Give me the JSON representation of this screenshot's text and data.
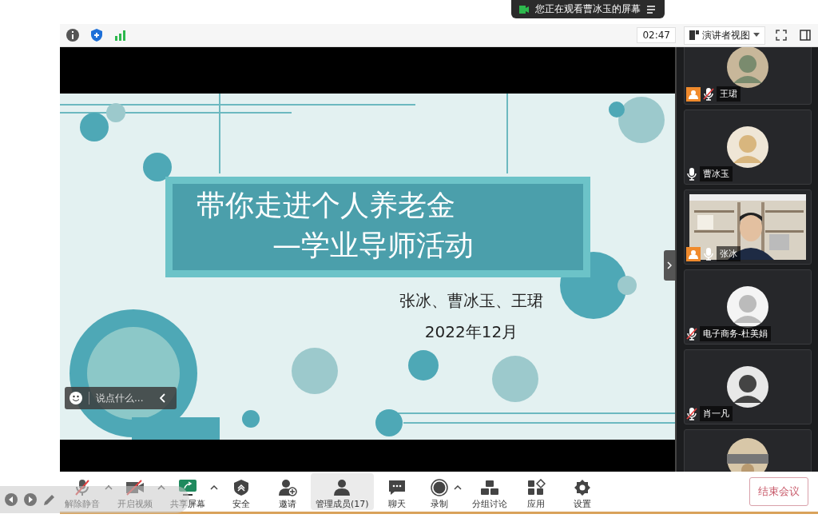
{
  "notice": {
    "text": "您正在观看曹冰玉的屏幕"
  },
  "top_bar": {
    "timer": "02:47",
    "view_button": "演讲者视图"
  },
  "slide": {
    "title_lines": [
      "带你走进个人养老金",
      "—学业导师活动"
    ],
    "authors": "张冰、曹冰玉、王珺",
    "date": "2022年12月"
  },
  "chat_box": {
    "placeholder": "说点什么..."
  },
  "participants": [
    {
      "name": "王珺",
      "muted": true,
      "host": true,
      "kind": "avatar"
    },
    {
      "name": "曹冰玉",
      "muted": false,
      "host": false,
      "kind": "avatar"
    },
    {
      "name": "张冰",
      "muted": false,
      "host": true,
      "kind": "video"
    },
    {
      "name": "电子商务-杜美娟",
      "muted": true,
      "host": false,
      "kind": "avatar"
    },
    {
      "name": "肖一凡",
      "muted": true,
      "host": false,
      "kind": "avatar"
    }
  ],
  "toolbar": [
    {
      "kind": "mic",
      "label": "解除静音",
      "has_menu": true,
      "selected": false
    },
    {
      "kind": "video",
      "label": "开启视频",
      "has_menu": true,
      "selected": false
    },
    {
      "kind": "share",
      "label": "共享屏幕",
      "has_menu": true,
      "selected": false
    },
    {
      "kind": "security",
      "label": "安全",
      "has_menu": false,
      "selected": false
    },
    {
      "kind": "invite",
      "label": "邀请",
      "has_menu": false,
      "selected": false
    },
    {
      "kind": "members",
      "label": "管理成员(17)",
      "has_menu": false,
      "selected": true
    },
    {
      "kind": "chat",
      "label": "聊天",
      "has_menu": false,
      "selected": false
    },
    {
      "kind": "record",
      "label": "录制",
      "has_menu": true,
      "selected": false
    },
    {
      "kind": "breakout",
      "label": "分组讨论",
      "has_menu": false,
      "selected": false
    },
    {
      "kind": "apps",
      "label": "应用",
      "has_menu": false,
      "selected": false
    },
    {
      "kind": "settings",
      "label": "设置",
      "has_menu": false,
      "selected": false
    }
  ],
  "end_button": "结束会议"
}
